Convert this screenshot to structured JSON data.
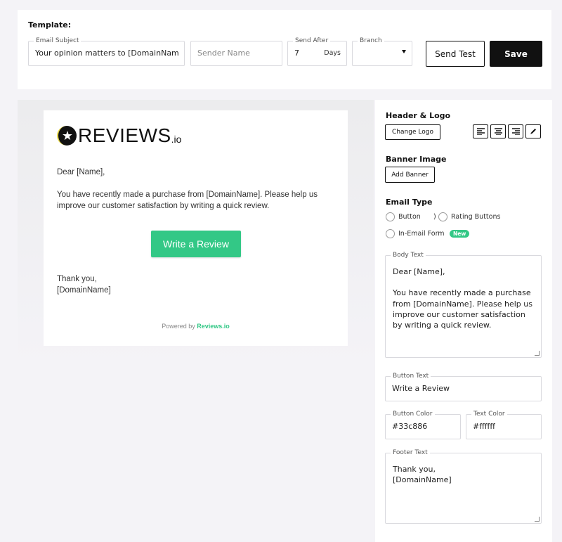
{
  "template": {
    "title": "Template:",
    "subject": {
      "label": "Email Subject",
      "value": "Your opinion matters to [DomainName]"
    },
    "sender": {
      "placeholder": "Sender Name"
    },
    "send_after": {
      "label": "Send After",
      "value": "7",
      "unit": "Days"
    },
    "branch": {
      "label": "Branch",
      "value": "",
      "icon": "caret-down-icon"
    },
    "send_test_label": "Send Test",
    "save_label": "Save"
  },
  "preview": {
    "logo": {
      "star_glyph": "★",
      "text": "REVIEWS",
      "suffix": ".io"
    },
    "greeting": "Dear [Name],",
    "body": "You have recently made a purchase from [DomainName]. Please help us improve our customer satisfaction by writing a quick review.",
    "button_label": "Write a Review",
    "footer_line1": "Thank you,",
    "footer_line2": "[DomainName]",
    "powered_by": "Powered by",
    "powered_brand": "Reviews.io"
  },
  "panel": {
    "header_logo": {
      "title": "Header & Logo",
      "change_logo_label": "Change Logo",
      "align_icons": [
        "align-left-icon",
        "align-center-icon",
        "align-right-icon",
        "pencil-icon"
      ]
    },
    "banner": {
      "title": "Banner Image",
      "add_banner_label": "Add Banner"
    },
    "email_type": {
      "title": "Email Type",
      "options": [
        {
          "label": "Button"
        },
        {
          "label": "Rating Buttons"
        },
        {
          "label": "In-Email Form",
          "badge": "New"
        }
      ],
      "stray_char": ")"
    },
    "body_text": {
      "label": "Body Text",
      "value": "Dear [Name],\n\nYou have recently made a purchase from [DomainName]. Please help us improve our customer satisfaction by writing a quick review."
    },
    "button_text": {
      "label": "Button Text",
      "value": "Write a Review"
    },
    "button_color": {
      "label": "Button Color",
      "value": "#33c886"
    },
    "text_color": {
      "label": "Text Color",
      "value": "#ffffff"
    },
    "footer_text": {
      "label": "Footer Text",
      "value": "Thank you,\n[DomainName]"
    }
  },
  "colors": {
    "accent": "#33c886",
    "dark": "#111111"
  }
}
